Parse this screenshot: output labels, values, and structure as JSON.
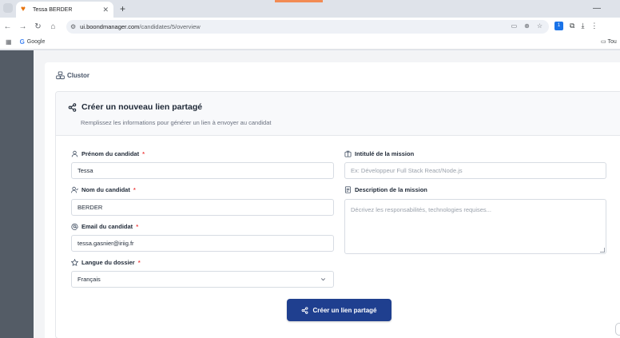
{
  "browser": {
    "tab_title": "Tessa BERDER",
    "url_host": "ui.boondmanager.com",
    "url_path": "/candidates/5/overview",
    "ext_badge": "1",
    "bookmark_google": "Google",
    "bookmark_folder": "Tou"
  },
  "app": {
    "brand": "Clustor"
  },
  "form": {
    "title": "Créer un nouveau lien partagé",
    "subtitle": "Remplissez les informations pour générer un lien à envoyer au candidat",
    "firstname_label": "Prénom du candidat",
    "firstname_value": "Tessa",
    "lastname_label": "Nom du candidat",
    "lastname_value": "BERDER",
    "email_label": "Email du candidat",
    "email_value": "tessa.gasnier@iriig.fr",
    "language_label": "Langue du dossier",
    "language_value": "Français",
    "mission_title_label": "Intitulé de la mission",
    "mission_title_placeholder": "Ex: Développeur Full Stack React/Node.js",
    "mission_desc_label": "Description de la mission",
    "mission_desc_placeholder": "Décrivez les responsabilités, technologies requises...",
    "required_mark": "*",
    "submit_label": "Créer un lien partagé"
  },
  "colors": {
    "primary_button": "#1f3f8f",
    "required": "#ef4444",
    "sidebar": "#545c66"
  }
}
